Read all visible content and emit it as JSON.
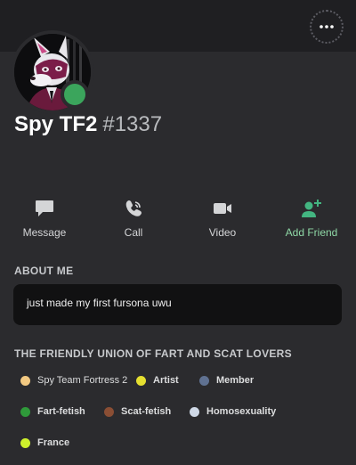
{
  "profile": {
    "username": "Spy TF2",
    "discriminator": "#1337",
    "status": "online"
  },
  "header": {
    "more_icon": "ellipsis-icon"
  },
  "actions": [
    {
      "label": "Message",
      "icon": "chat-bubble-icon"
    },
    {
      "label": "Call",
      "icon": "phone-icon"
    },
    {
      "label": "Video",
      "icon": "video-camera-icon"
    },
    {
      "label": "Add Friend",
      "icon": "add-friend-icon"
    }
  ],
  "about": {
    "title": "ABOUT ME",
    "text": "just made my first fursona uwu"
  },
  "server": {
    "title": "THE FRIENDLY UNION OF FART AND SCAT LOVERS",
    "roles": [
      {
        "name": "Spy Team Fortress 2",
        "color": "#f2c982"
      },
      {
        "name": "Artist",
        "color": "#e6e030"
      },
      {
        "name": "Member",
        "color": "#5f7191"
      },
      {
        "name": "Fart-fetish",
        "color": "#2f9a3a"
      },
      {
        "name": "Scat-fetish",
        "color": "#8a4e34"
      },
      {
        "name": "Homosexuality",
        "color": "#cfd8e6"
      },
      {
        "name": "France",
        "color": "#cdf02c"
      }
    ]
  },
  "colors": {
    "background": "#2b2b2e",
    "banner": "#1f1f22",
    "online": "#3ba55c",
    "add_friend": "#43b581"
  }
}
